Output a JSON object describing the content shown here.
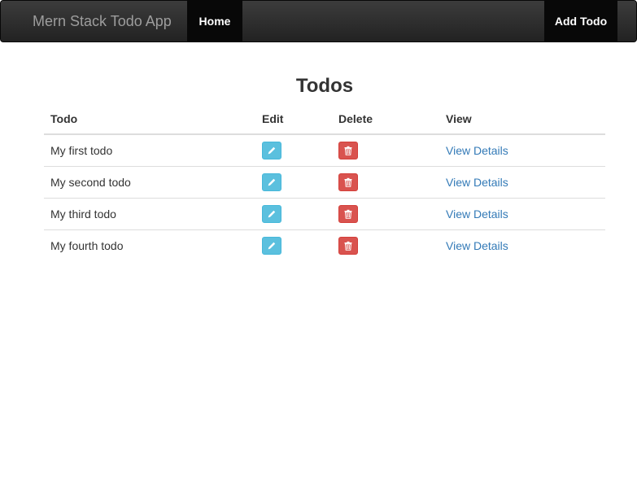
{
  "navbar": {
    "brand": "Mern Stack Todo App",
    "home_label": "Home",
    "add_label": "Add Todo"
  },
  "page": {
    "title": "Todos"
  },
  "table": {
    "headers": {
      "todo": "Todo",
      "edit": "Edit",
      "delete": "Delete",
      "view": "View"
    },
    "rows": [
      {
        "todo": "My first todo",
        "view": "View Details"
      },
      {
        "todo": "My second todo",
        "view": "View Details"
      },
      {
        "todo": "My third todo",
        "view": "View Details"
      },
      {
        "todo": "My fourth todo",
        "view": "View Details"
      }
    ]
  },
  "icons": {
    "edit": "pencil-icon",
    "delete": "trash-icon"
  },
  "colors": {
    "navbar": "#222222",
    "edit_button": "#5bc0de",
    "delete_button": "#d9534f",
    "link": "#337ab7"
  }
}
